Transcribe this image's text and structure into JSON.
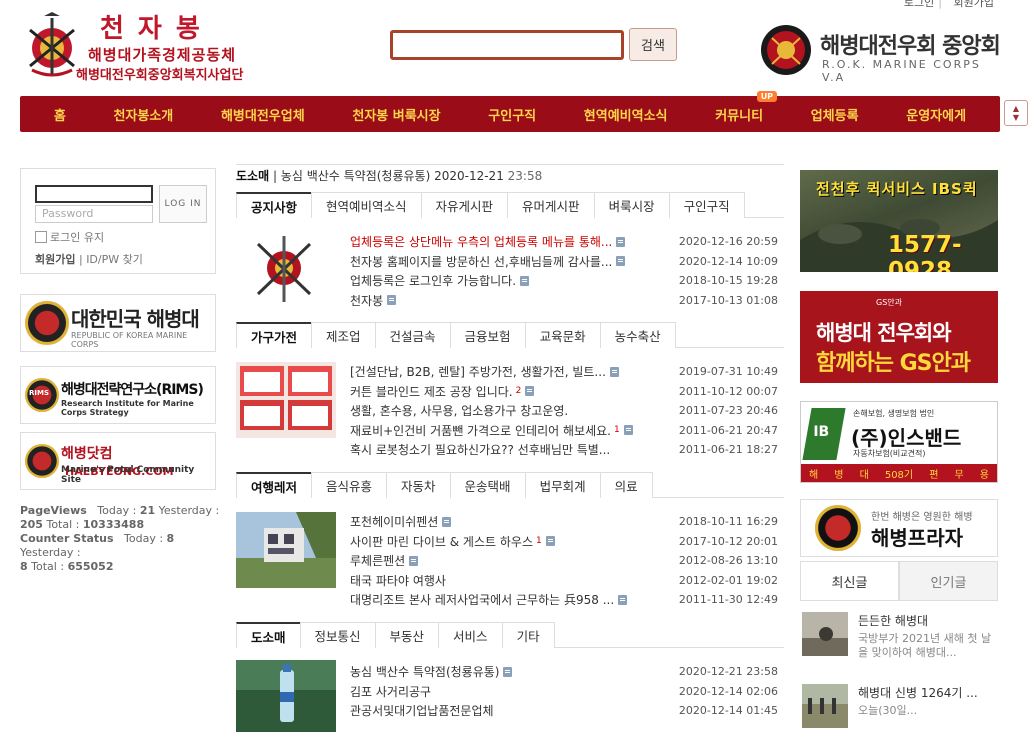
{
  "util": {
    "login": "로그인",
    "join": "회원가입"
  },
  "logo": {
    "title": "천자봉",
    "line1": "해병대가족경제공동체",
    "line2": "해병대전우회중앙회복지사업단"
  },
  "search": {
    "value": "",
    "button": "검색"
  },
  "brand": {
    "title": "해병대전우회 중앙회",
    "subtitle": "R.O.K. MARINE CORPS V.A"
  },
  "nav": {
    "items": [
      "홈",
      "천자봉소개",
      "해병대전우업체",
      "천자봉 벼룩시장",
      "구인구직",
      "현역예비역소식",
      "커뮤니티",
      "업체등록",
      "운영자에게"
    ],
    "up_badge": "UP"
  },
  "login": {
    "id_value": "",
    "pw_placeholder": "Password",
    "button": "LOG IN",
    "keep": "로그인 유지",
    "join": "회원가입",
    "find": "ID/PW 찾기"
  },
  "left_banners": [
    {
      "title": "대한민국 해병대",
      "sub": "REPUBLIC OF KOREA MARINE CORPS"
    },
    {
      "title": "해병대전략연구소(RIMS)",
      "sub": "Research Institute for Marine Corps Strategy",
      "badge": "RIMS"
    },
    {
      "title": "해병닷컴",
      "title2": "HAEBYEONG.COM",
      "sub": "Marine's Potal Community Site"
    }
  ],
  "counter": {
    "pv_label": "PageViews",
    "today_label": "Today :",
    "today": "21",
    "yesterday_label": "Yesterday :",
    "yesterday": "205",
    "total_label": "Total :",
    "total": "10333488",
    "cs_label": "Counter Status",
    "cs_today": "8",
    "cs_yesterday": "8",
    "cs_total": "655052"
  },
  "news": {
    "category": "도소매",
    "text": "농심 백산수 특약점(청룡유통) 2020-12-21",
    "time": "23:58"
  },
  "sections": [
    {
      "tabs": [
        "공지사항",
        "현역예비역소식",
        "자유게시판",
        "유머게시판",
        "벼룩시장",
        "구인구직"
      ],
      "rows": [
        {
          "title": "업체등록은 상단메뉴 우측의 업체등록 메뉴를 통해...",
          "date": "2020-12-16",
          "time": "20:59",
          "red": true
        },
        {
          "title": "천자봉 홈페이지를 방문하신 선,후배님들께 감사를...",
          "date": "2020-12-14",
          "time": "10:09"
        },
        {
          "title": "업체등록은 로그인후 가능합니다.",
          "date": "2018-10-15",
          "time": "19:28"
        },
        {
          "title": "천자봉",
          "date": "2017-10-13",
          "time": "01:08"
        }
      ]
    },
    {
      "tabs": [
        "가구가전",
        "제조업",
        "건설금속",
        "금융보험",
        "교육문화",
        "농수축산"
      ],
      "rows": [
        {
          "title": "[건설단납, B2B, 렌탈] 주방가전, 생활가전, 빌트...",
          "date": "2019-07-31",
          "time": "10:49"
        },
        {
          "title": "커튼 블라인드 제조 공장 입니다.",
          "comments": "2",
          "date": "2011-10-12",
          "time": "00:07"
        },
        {
          "title": "생활, 혼수용, 사무용, 업소용가구 창고운영.",
          "date": "2011-07-23",
          "time": "20:46"
        },
        {
          "title": "재료비+인건비 거품뺀 가격으로 인테리어 해보세요.",
          "comments": "1",
          "date": "2011-06-21",
          "time": "20:47"
        },
        {
          "title": "혹시 로봇청소기 필요하신가요?? 선후배님만 특별...",
          "date": "2011-06-21",
          "time": "18:27"
        }
      ]
    },
    {
      "tabs": [
        "여행레저",
        "음식유흥",
        "자동차",
        "운송택배",
        "법무회계",
        "의료"
      ],
      "rows": [
        {
          "title": "포천헤이미쉬펜션",
          "date": "2018-10-11",
          "time": "16:29"
        },
        {
          "title": "사이판 마린 다이브 & 게스트 하우스",
          "comments": "1",
          "date": "2017-10-12",
          "time": "20:01"
        },
        {
          "title": "루체른펜션",
          "date": "2012-08-26",
          "time": "13:10"
        },
        {
          "title": "태국 파타야 여행사",
          "date": "2012-02-01",
          "time": "19:02"
        },
        {
          "title": "대명리조트 본사 레저사업국에서 근무하는 兵958 ...",
          "date": "2011-11-30",
          "time": "12:49"
        }
      ]
    },
    {
      "tabs": [
        "도소매",
        "정보통신",
        "부동산",
        "서비스",
        "기타"
      ],
      "rows": [
        {
          "title": "농심 백산수 특약점(청룡유통)",
          "date": "2020-12-21",
          "time": "23:58"
        },
        {
          "title": "김포 사거리공구",
          "date": "2020-12-14",
          "time": "02:06"
        },
        {
          "title": "관공서및대기업납품전문업체",
          "date": "2020-12-14",
          "time": "01:45"
        }
      ]
    }
  ],
  "right_banners": {
    "ibs": {
      "headline": "전천후 퀵서비스 IBS퀵",
      "phone": "1577-0928"
    },
    "gs": {
      "brand": "GS안과",
      "line1": "해병대 전우회와",
      "line2": "함께하는 GS안과"
    },
    "ins": {
      "logo": "IB",
      "small1": "손해보험, 생명보험 법인",
      "main": "(주)인스밴드",
      "small2": "자동차보험(비교견적)",
      "bar": [
        "해",
        "병",
        "대",
        "508기",
        "편",
        "무",
        "용"
      ]
    },
    "plaza": {
      "small": "한번 해병은 영원한 해병",
      "main": "해병프라자"
    }
  },
  "latest_tabs": [
    "최신글",
    "인기글"
  ],
  "latest": [
    {
      "title": "든든한 해병대",
      "desc": "국방부가 2021년 새해 첫 날을 맞이하여 해병대..."
    },
    {
      "title": "해병대 신병 1264기 ...",
      "desc": "오늘(30일..."
    }
  ],
  "colors": {
    "nav_bg": "#9a0d18",
    "nav_text": "#ffd54a",
    "accent_red": "#b3121f"
  }
}
